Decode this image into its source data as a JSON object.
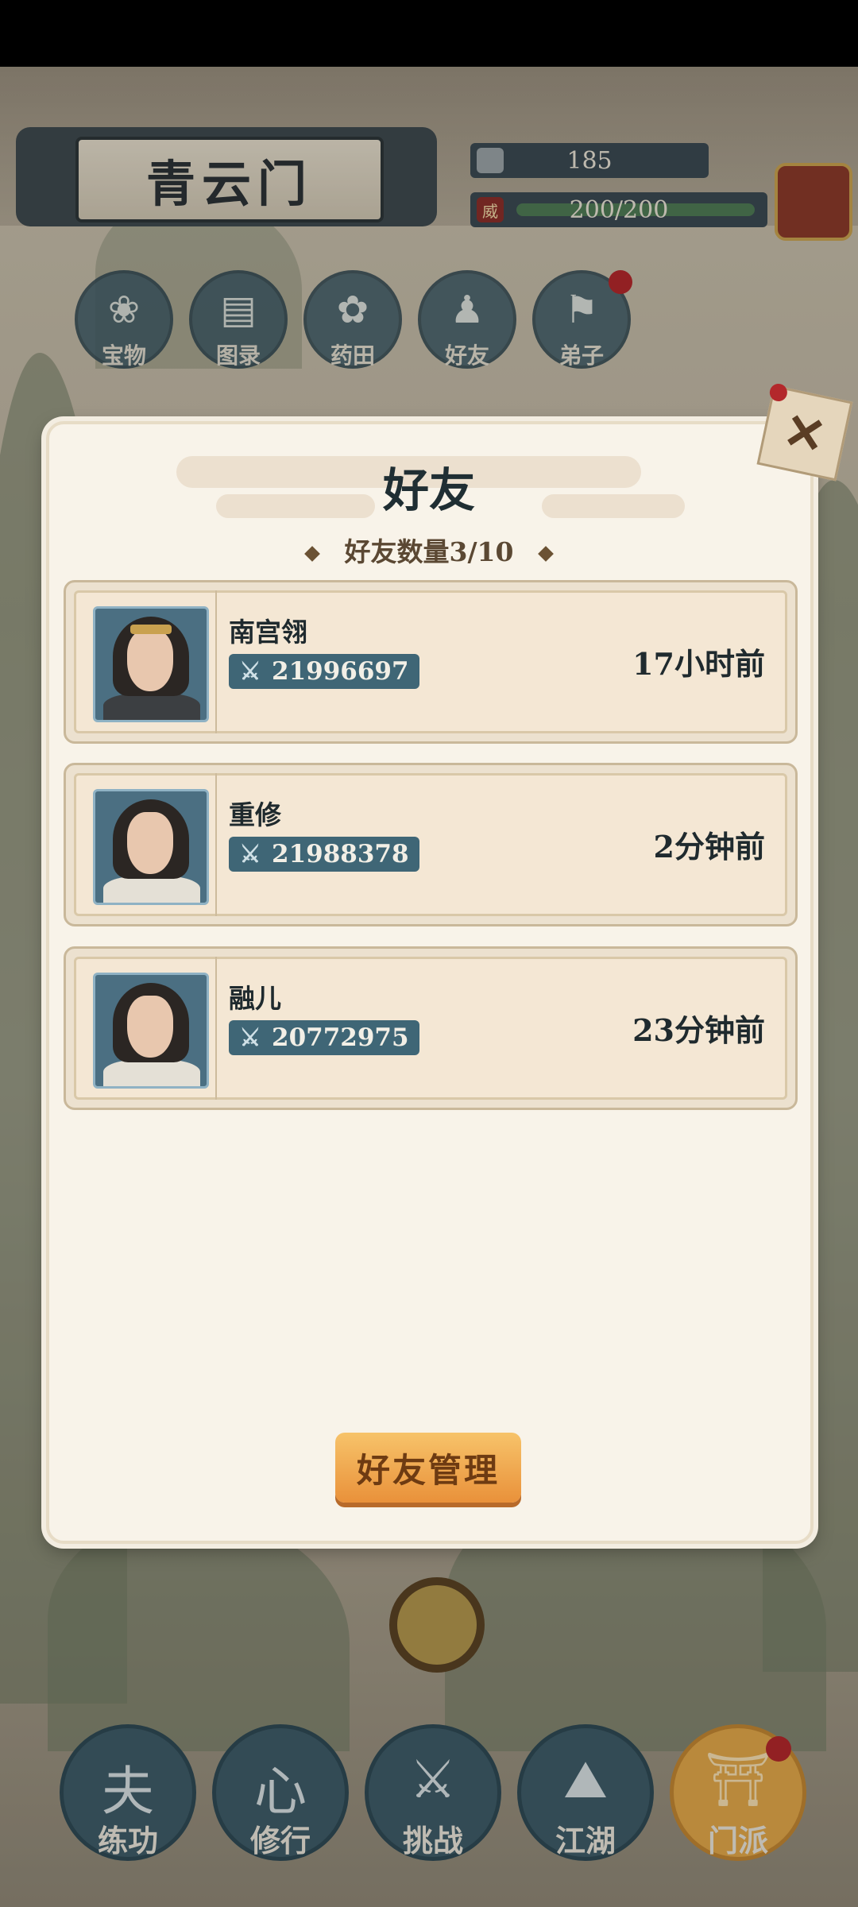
{
  "header": {
    "sect_name": "青云门",
    "currency": "185",
    "stamina": "200/200",
    "stamina_icon": "威",
    "stamina_fraction": 1.0
  },
  "top_menu": [
    {
      "label": "宝物",
      "icon": "treasure-bag-icon",
      "glyph": "❀"
    },
    {
      "label": "图录",
      "icon": "scroll-icon",
      "glyph": "▤"
    },
    {
      "label": "药田",
      "icon": "herb-field-icon",
      "glyph": "✿"
    },
    {
      "label": "好友",
      "icon": "friends-icon",
      "glyph": "♟"
    },
    {
      "label": "弟子",
      "icon": "disciple-icon",
      "glyph": "⚑"
    }
  ],
  "dialog": {
    "title": "好友",
    "count_label": "好友数量3/10",
    "manage_button": "好友管理",
    "close_glyph": "✕"
  },
  "friends": [
    {
      "name": "南宫翎",
      "power": "21996697",
      "last_seen": "17小时前"
    },
    {
      "name": "重修",
      "power": "21988378",
      "last_seen": "2分钟前"
    },
    {
      "name": "融儿",
      "power": "20772975",
      "last_seen": "23分钟前"
    }
  ],
  "bottom_nav": [
    {
      "label": "练功",
      "glyph": "夫",
      "icon": "training-icon"
    },
    {
      "label": "修行",
      "glyph": "心",
      "icon": "cultivation-icon"
    },
    {
      "label": "挑战",
      "glyph": "⚔",
      "icon": "challenge-swords-icon"
    },
    {
      "label": "江湖",
      "glyph": "⛰",
      "icon": "jianghu-mountain-icon"
    },
    {
      "label": "门派",
      "glyph": "⛩",
      "icon": "sect-gate-icon",
      "active": true
    }
  ],
  "colors": {
    "panel_bg": "#f8f3e9",
    "accent_button": "#e9913a",
    "power_badge": "#3f6676",
    "notification": "#b3282b"
  }
}
